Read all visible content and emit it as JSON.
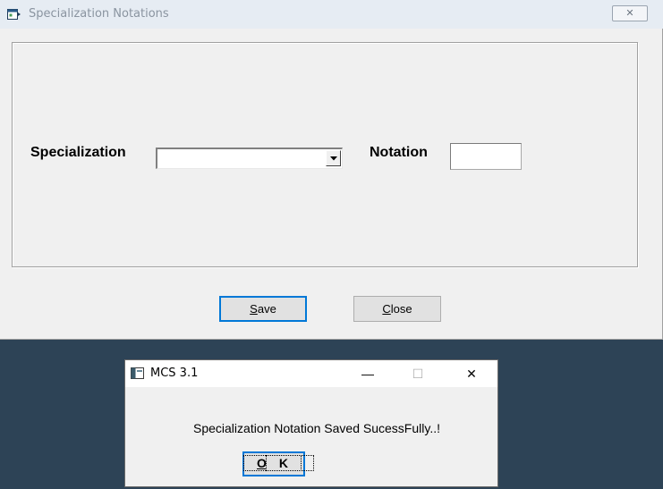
{
  "main_window": {
    "title": "Specialization Notations",
    "close_glyph": "✕",
    "specialization_label": "Specialization",
    "specialization_value": "",
    "notation_label": "Notation",
    "notation_value": "",
    "save_label": "Save",
    "save_mnemonic": "S",
    "save_rest": "ave",
    "close_label": "Close",
    "close_mnemonic": "C",
    "close_rest": "lose"
  },
  "message_box": {
    "title": "MCS 3.1",
    "message": "Specialization Notation Saved SucessFully..!",
    "ok_label": "OK",
    "ok_mnemonic": "O",
    "ok_rest": "K",
    "minimize_glyph": "—",
    "maximize_glyph": "☐",
    "close_glyph": "✕"
  },
  "icons": {
    "app_icon": "app-window-icon",
    "dropdown_icon": "chevron-down-icon",
    "msg_icon": "console-window-icon"
  },
  "colors": {
    "desktop": "#2d4356",
    "focus_accent": "#0078d7",
    "dialog_bg": "#f0f0f0"
  }
}
